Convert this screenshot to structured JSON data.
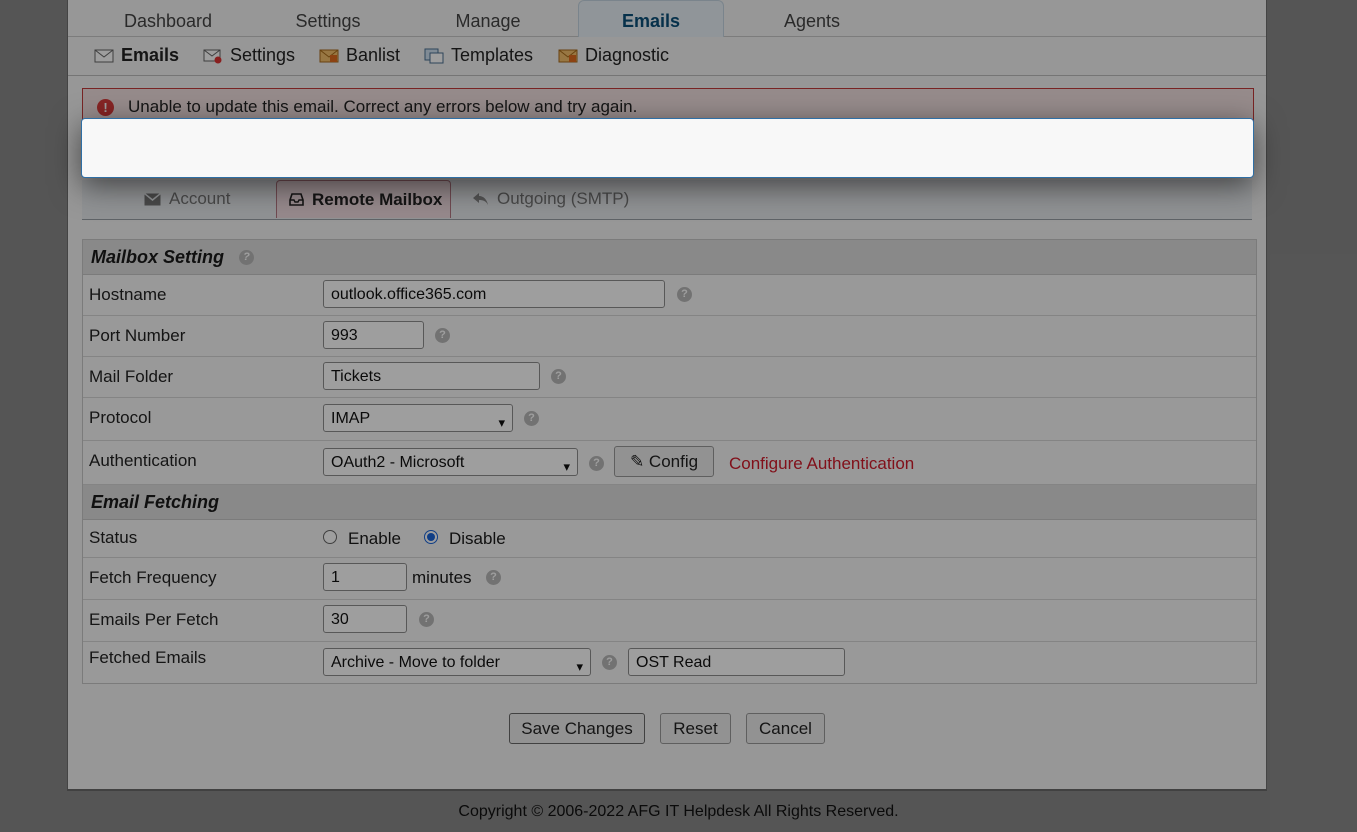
{
  "nav": {
    "tabs": [
      {
        "label": "Dashboard"
      },
      {
        "label": "Settings"
      },
      {
        "label": "Manage"
      },
      {
        "label": "Emails"
      },
      {
        "label": "Agents"
      }
    ],
    "active_tab": "Emails"
  },
  "subnav": {
    "items": [
      {
        "label": "Emails",
        "icon": "envelope-icon"
      },
      {
        "label": "Settings",
        "icon": "envelope-gear-icon"
      },
      {
        "label": "Banlist",
        "icon": "ban-envelope-icon"
      },
      {
        "label": "Templates",
        "icon": "templates-icon"
      },
      {
        "label": "Diagnostic",
        "icon": "diagnostic-icon"
      }
    ],
    "active_item": "Emails"
  },
  "error": {
    "message": "Unable to update this email. Correct any errors below and try again.",
    "icon": "!"
  },
  "tabs": {
    "items": [
      {
        "label": "Account",
        "icon": "envelope-icon"
      },
      {
        "label": "Remote Mailbox",
        "icon": "inbox-icon"
      },
      {
        "label": "Outgoing (SMTP)",
        "icon": "reply-icon"
      }
    ],
    "active": "Remote Mailbox"
  },
  "mailbox": {
    "heading": "Mailbox Setting",
    "hostname_label": "Hostname",
    "hostname_value": "outlook.office365.com",
    "port_label": "Port Number",
    "port_value": "993",
    "folder_label": "Mail Folder",
    "folder_value": "Tickets",
    "protocol_label": "Protocol",
    "protocol_value": "IMAP",
    "auth_label": "Authentication",
    "auth_value": "OAuth2 - Microsoft",
    "config_button": "Config",
    "configure_link": "Configure Authentication"
  },
  "fetching": {
    "heading": "Email Fetching",
    "status_label": "Status",
    "status_enable": "Enable",
    "status_disable": "Disable",
    "status_selected": "Disable",
    "frequency_label": "Fetch Frequency",
    "frequency_value": "1",
    "frequency_unit": "minutes",
    "per_fetch_label": "Emails Per Fetch",
    "per_fetch_value": "30",
    "fetched_label": "Fetched Emails",
    "fetched_action": "Archive - Move to folder",
    "fetched_folder": "OST Read"
  },
  "buttons": {
    "save": "Save Changes",
    "reset": "Reset",
    "cancel": "Cancel"
  },
  "help_glyph": "?",
  "footer": {
    "copyright": "Copyright © 2006-2022 AFG IT Helpdesk All Rights Reserved."
  },
  "colors": {
    "active_tab_text": "#0b4f7a",
    "error_border": "#c23a3a",
    "link_red": "#d11a2a",
    "popup_border": "#2f6fa5"
  }
}
